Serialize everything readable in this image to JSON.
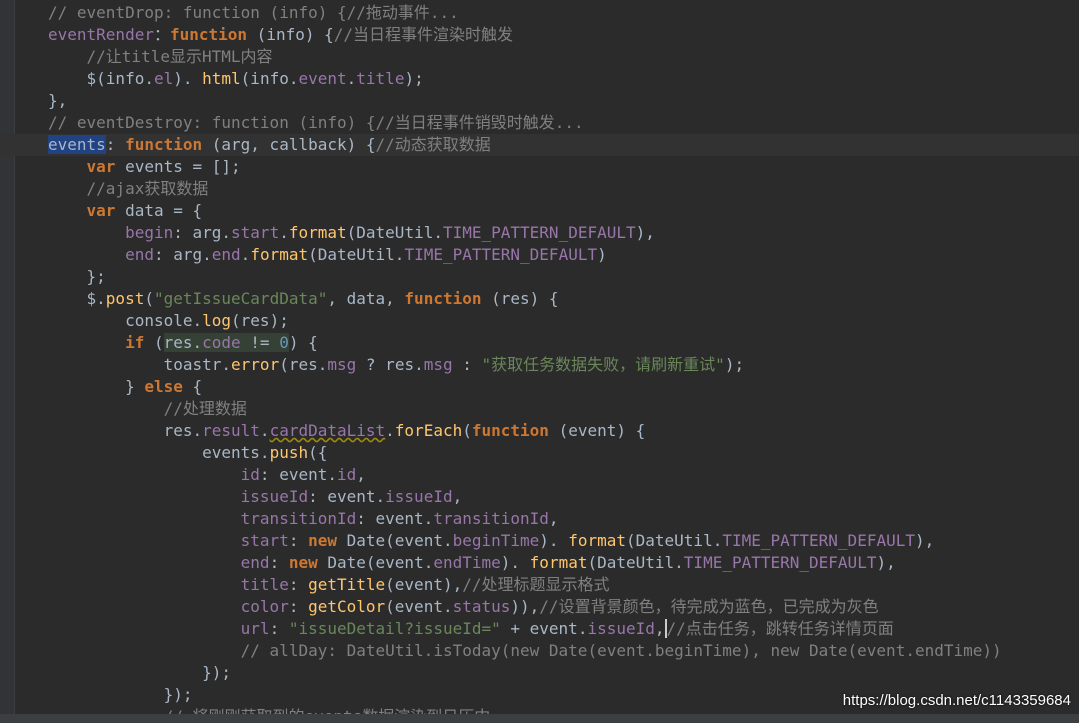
{
  "editor": {
    "lines": [
      [
        [
          "cmt",
          "// eventDrop: function (info) {//拖动事件..."
        ]
      ],
      [
        [
          "prop",
          "eventRender"
        ],
        [
          "",
          "："
        ],
        [
          "kw",
          "function"
        ],
        [
          "",
          " (info) {"
        ],
        [
          "cmt",
          "//当日程事件渲染时触发"
        ]
      ],
      [
        [
          "",
          ""
        ],
        [
          "cmt",
          "    //让title显示HTML内容"
        ]
      ],
      [
        [
          "",
          "    $(info."
        ],
        [
          "prop",
          "el"
        ],
        [
          "",
          "). "
        ],
        [
          "fn",
          "html"
        ],
        [
          "",
          "(info."
        ],
        [
          "prop",
          "event"
        ],
        [
          "",
          "."
        ],
        [
          "prop",
          "title"
        ],
        [
          "",
          ");"
        ]
      ],
      [
        [
          "",
          "},"
        ]
      ],
      [
        [
          "cmt",
          "// eventDestroy: function (info) {//当日程事件销毁时触发..."
        ]
      ],
      [
        [
          "sel",
          "events"
        ],
        [
          "",
          ": "
        ],
        [
          "kw",
          "function"
        ],
        [
          "",
          " (arg, callback) {"
        ],
        [
          "cmt",
          "//动态获取数据"
        ]
      ],
      [
        [
          "",
          "    "
        ],
        [
          "kw",
          "var"
        ],
        [
          "",
          " events = [];"
        ]
      ],
      [
        [
          "cmt",
          "    //ajax获取数据"
        ]
      ],
      [
        [
          "",
          "    "
        ],
        [
          "kw",
          "var"
        ],
        [
          "",
          " data = {"
        ]
      ],
      [
        [
          "",
          "        "
        ],
        [
          "prop",
          "begin"
        ],
        [
          "",
          ": arg."
        ],
        [
          "prop",
          "start"
        ],
        [
          "",
          "."
        ],
        [
          "fn",
          "format"
        ],
        [
          "",
          "(DateUtil."
        ],
        [
          "prop",
          "TIME_PATTERN_DEFAULT"
        ],
        [
          "",
          "),"
        ]
      ],
      [
        [
          "",
          "        "
        ],
        [
          "prop",
          "end"
        ],
        [
          "",
          ": arg."
        ],
        [
          "prop",
          "end"
        ],
        [
          "",
          "."
        ],
        [
          "fn",
          "format"
        ],
        [
          "",
          "(DateUtil."
        ],
        [
          "prop",
          "TIME_PATTERN_DEFAULT"
        ],
        [
          "",
          ")"
        ]
      ],
      [
        [
          "",
          "    };"
        ]
      ],
      [
        [
          "",
          "    $."
        ],
        [
          "fn",
          "post"
        ],
        [
          "",
          "("
        ],
        [
          "str",
          "\"getIssueCardData\""
        ],
        [
          "",
          ", data, "
        ],
        [
          "kw",
          "function"
        ],
        [
          "",
          " (res) {"
        ]
      ],
      [
        [
          "",
          "        console."
        ],
        [
          "fn",
          "log"
        ],
        [
          "",
          "(res);"
        ]
      ],
      [
        [
          "",
          "        "
        ],
        [
          "kw",
          "if"
        ],
        [
          "",
          " ("
        ],
        [
          "hl",
          "res."
        ],
        [
          "hl prop",
          "code"
        ],
        [
          "hl",
          " != "
        ],
        [
          "hl num",
          "0"
        ],
        [
          "",
          ") {"
        ]
      ],
      [
        [
          "",
          "            toastr."
        ],
        [
          "fn",
          "error"
        ],
        [
          "",
          "(res."
        ],
        [
          "prop",
          "msg"
        ],
        [
          "",
          " ? res."
        ],
        [
          "prop",
          "msg"
        ],
        [
          "",
          " : "
        ],
        [
          "str",
          "\"获取任务数据失败，请刷新重试\""
        ],
        [
          "",
          ");"
        ]
      ],
      [
        [
          "",
          "        } "
        ],
        [
          "kw",
          "else"
        ],
        [
          "",
          " {"
        ]
      ],
      [
        [
          "cmt",
          "            //处理数据"
        ]
      ],
      [
        [
          "",
          "            res."
        ],
        [
          "prop",
          "result"
        ],
        [
          "",
          "."
        ],
        [
          "warn prop",
          "cardDataList"
        ],
        [
          "",
          "."
        ],
        [
          "fn",
          "forEach"
        ],
        [
          "",
          "("
        ],
        [
          "kw",
          "function"
        ],
        [
          "",
          " (event) {"
        ]
      ],
      [
        [
          "",
          "                events."
        ],
        [
          "fn",
          "push"
        ],
        [
          "",
          "({"
        ]
      ],
      [
        [
          "",
          "                    "
        ],
        [
          "prop",
          "id"
        ],
        [
          "",
          ": event."
        ],
        [
          "prop",
          "id"
        ],
        [
          "",
          ","
        ]
      ],
      [
        [
          "",
          "                    "
        ],
        [
          "prop",
          "issueId"
        ],
        [
          "",
          ": event."
        ],
        [
          "prop",
          "issueId"
        ],
        [
          "",
          ","
        ]
      ],
      [
        [
          "",
          "                    "
        ],
        [
          "prop",
          "transitionId"
        ],
        [
          "",
          ": event."
        ],
        [
          "prop",
          "transitionId"
        ],
        [
          "",
          ","
        ]
      ],
      [
        [
          "",
          "                    "
        ],
        [
          "prop",
          "start"
        ],
        [
          "",
          ": "
        ],
        [
          "kw",
          "new"
        ],
        [
          "",
          " Date(event."
        ],
        [
          "prop",
          "beginTime"
        ],
        [
          "",
          "). "
        ],
        [
          "fn",
          "format"
        ],
        [
          "",
          "(DateUtil."
        ],
        [
          "prop",
          "TIME_PATTERN_DEFAULT"
        ],
        [
          "",
          "),"
        ]
      ],
      [
        [
          "",
          "                    "
        ],
        [
          "prop",
          "end"
        ],
        [
          "",
          ": "
        ],
        [
          "kw",
          "new"
        ],
        [
          "",
          " Date(event."
        ],
        [
          "prop",
          "endTime"
        ],
        [
          "",
          "). "
        ],
        [
          "fn",
          "format"
        ],
        [
          "",
          "(DateUtil."
        ],
        [
          "prop",
          "TIME_PATTERN_DEFAULT"
        ],
        [
          "",
          "),"
        ]
      ],
      [
        [
          "",
          "                    "
        ],
        [
          "prop",
          "title"
        ],
        [
          "",
          ": "
        ],
        [
          "fn",
          "getTitle"
        ],
        [
          "",
          "(event),"
        ],
        [
          "cmt",
          "//处理标题显示格式"
        ]
      ],
      [
        [
          "",
          "                    "
        ],
        [
          "prop",
          "color"
        ],
        [
          "",
          ": "
        ],
        [
          "fn",
          "getColor"
        ],
        [
          "",
          "(event."
        ],
        [
          "prop",
          "status"
        ],
        [
          "",
          ")),"
        ],
        [
          "cmt",
          "//设置背景颜色，待完成为蓝色，已完成为灰色"
        ]
      ],
      [
        [
          "",
          "                    "
        ],
        [
          "prop",
          "url"
        ],
        [
          "",
          ": "
        ],
        [
          "str",
          "\"issueDetail?issueId=\""
        ],
        [
          "",
          " + event."
        ],
        [
          "prop",
          "issueId"
        ],
        [
          "caret",
          ","
        ],
        [
          "cmt",
          "//点击任务，跳转任务详情页面"
        ]
      ],
      [
        [
          "cmt",
          "                    // allDay: DateUtil.isToday(new Date(event.beginTime), new Date(event.endTime))"
        ]
      ],
      [
        [
          "",
          "                });"
        ]
      ],
      [
        [
          "",
          "            });"
        ]
      ],
      [
        [
          "cmt",
          "            // 将刚刚获取到的events数据渲染到日历中"
        ]
      ]
    ]
  },
  "watermark": "https://blog.csdn.net/c1143359684"
}
